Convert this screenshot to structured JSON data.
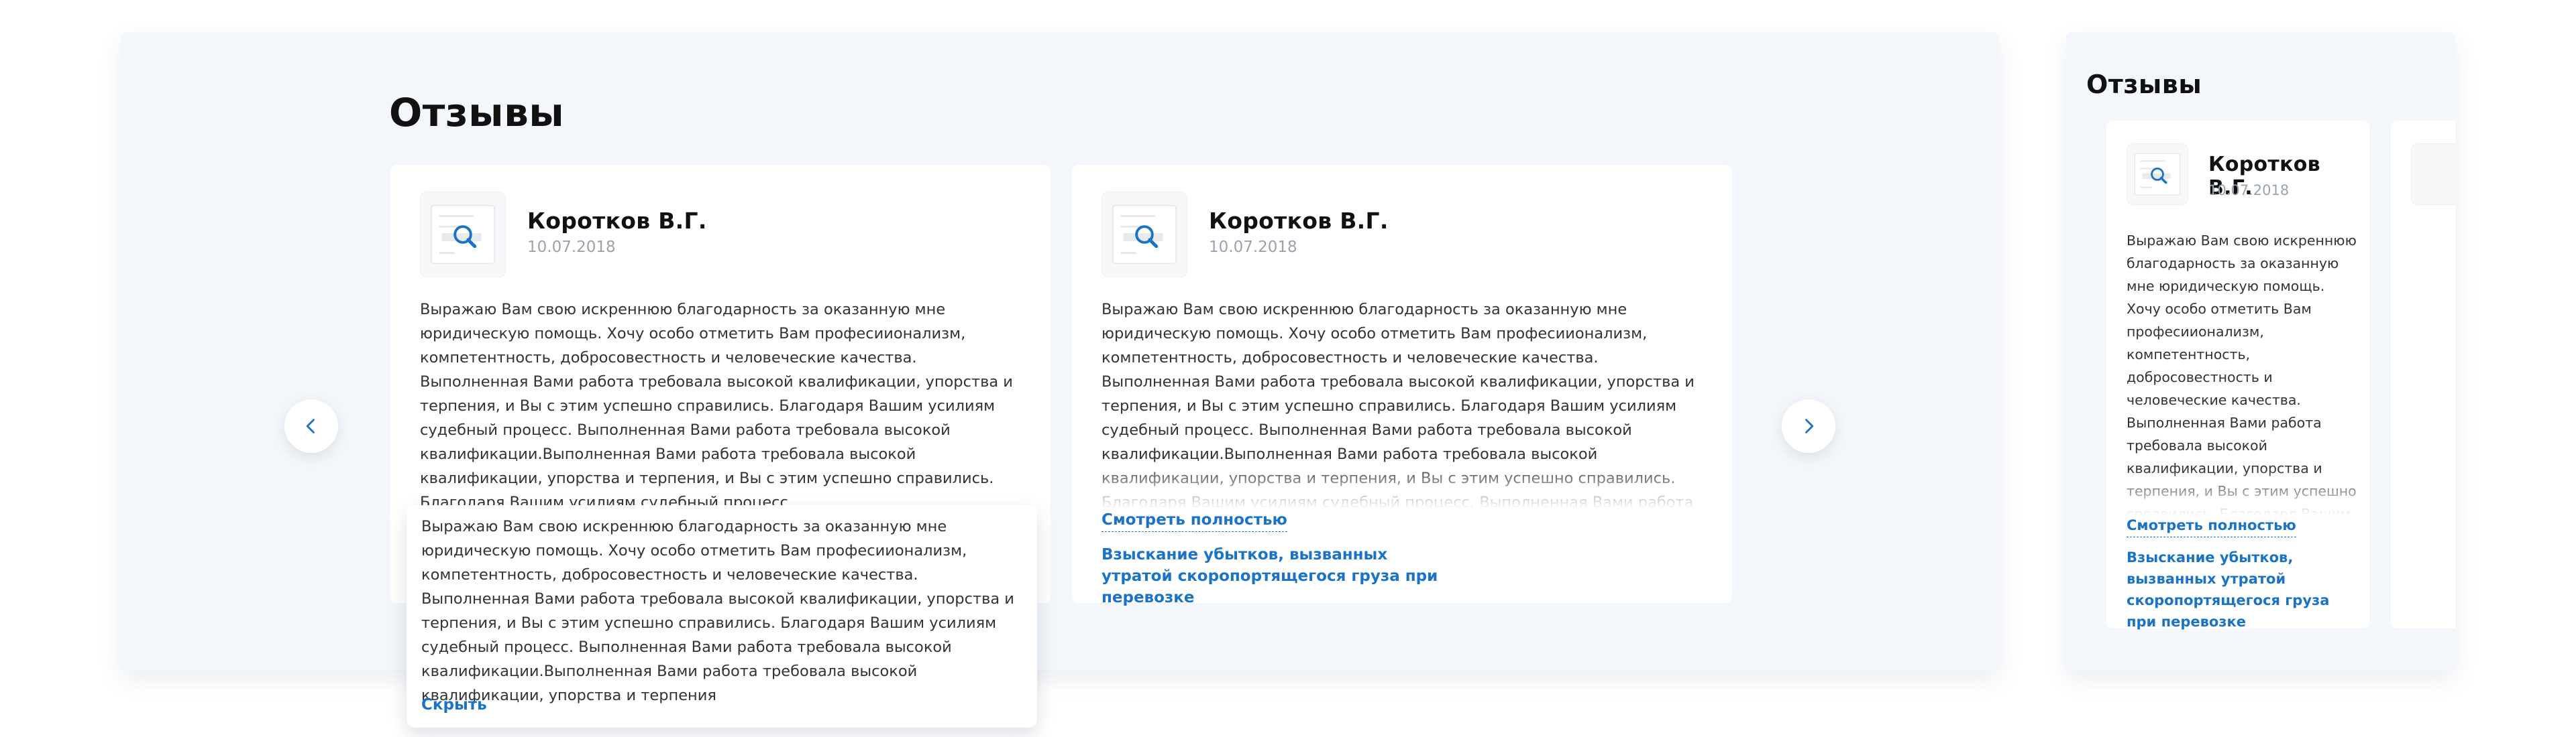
{
  "desktop": {
    "title": "Отзывы",
    "reviews": [
      {
        "author": "Коротков В.Г.",
        "date": "10.07.2018",
        "text": "Выражаю Вам свою искреннюю благодарность за оказанную мне юридическую помощь. Хочу особо отметить Вам професиионализм, компетентность, добросовестность и человеческие качества. Выполненная Вами работа требовала высокой квалификации, упорства и терпения, и Вы с этим успешно справились. Благодаря Вашим усилиям судебный процесс. Выполненная Вами работа требовала высокой квалификации.Выполненная Вами работа требовала высокой квалификации, упорства и терпения, и Вы с этим успешно справились. Благодаря Вашим усилиям судебный процесс.",
        "expanded_text": "Выражаю Вам свою искреннюю благодарность за оказанную мне юридическую помощь. Хочу особо отметить Вам професиионализм, компетентность, добросовестность и человеческие качества. Выполненная Вами работа требовала высокой квалификации, упорства и терпения, и Вы с этим успешно справились. Благодаря Вашим усилиям судебный процесс. Выполненная Вами работа требовала высокой квалификации.Выполненная Вами работа требовала высокой квалификации, упорства и терпения",
        "collapse_label": "Скрыть"
      },
      {
        "author": "Коротков В.Г.",
        "date": "10.07.2018",
        "text": "Выражаю Вам свою искреннюю благодарность за оказанную мне юридическую помощь. Хочу особо отметить Вам професиионализм, компетентность, добросовестность и человеческие качества. Выполненная Вами работа требовала высокой квалификации, упорства и терпения, и Вы с этим успешно справились. Благодаря Вашим усилиям судебный процесс. Выполненная Вами работа требовала высокой квалификации.Выполненная Вами работа требовала высокой квалификации, упорства и терпения, и Вы с этим успешно справились. Благодаря Вашим усилиям судебный процесс. Выполненная Вами работа требовала высокой квалификации. Выполненная Вами работа требовала",
        "expand_label": "Смотреть полностью",
        "case_link": "Взыскание убытков, вызванных утратой скоропортящегося груза при перевозке"
      }
    ],
    "nav": {
      "prev": "chevron-left-icon",
      "next": "chevron-right-icon"
    }
  },
  "mobile": {
    "title": "Отзывы",
    "review": {
      "author": "Коротков В.Г.",
      "date": "10.07.2018",
      "text": "Выражаю Вам свою искреннюю благодарность за оказанную мне юридическую помощь. Хочу особо отметить Вам професиионализм, компетентность, добросовестность и человеческие качества. Выполненная Вами работа требовала высокой квалификации, упорства и терпения, и Вы с этим успешно справились. Благодаря Вашим усилиям судебный процесс. Выполненная Вами работа требовала высокой квалификации. Выполненная Вами работа требовала",
      "expand_label": "Смотреть полностью",
      "case_link": "Взыскание убытков, вызванных утратой скоропортящегося груза при перевозке"
    }
  },
  "colors": {
    "panel_bg": "#f3f7fb",
    "accent": "#1b73c8",
    "card_bg": "#ffffff"
  }
}
